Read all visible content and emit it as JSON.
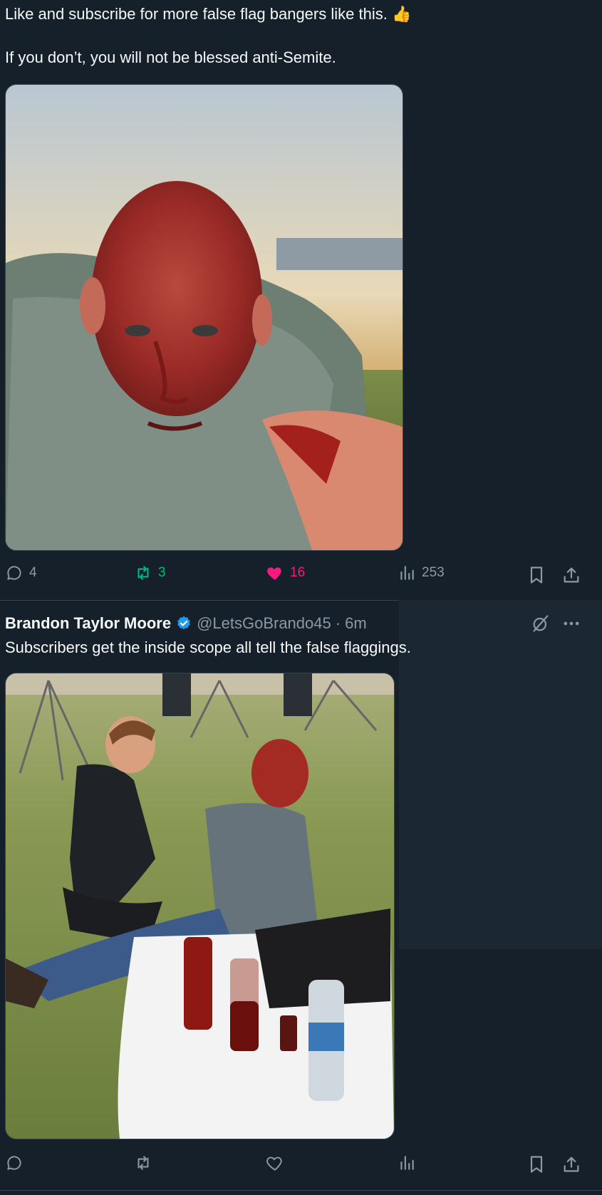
{
  "tweet1": {
    "line1": "Like and subscribe for more false flag bangers like this.",
    "line1_emoji": "👍",
    "line2": "If you don’t, you will not be blessed anti-Semite.",
    "media_icon": "photo",
    "actions": {
      "replies": "4",
      "reposts": "3",
      "likes": "16",
      "views": "253"
    }
  },
  "tweet2": {
    "author_name": "Brandon Taylor Moore",
    "verified": true,
    "handle": "@LetsGoBrando45",
    "separator": "·",
    "time": "6m",
    "text": "Subscribers get the inside scope all tell the false flaggings.",
    "media_icon": "photo",
    "actions": {
      "replies": "",
      "reposts": "",
      "likes": "",
      "views": ""
    }
  },
  "colors": {
    "background": "#15202b",
    "accent_blue": "#1d9bf0",
    "repost_green": "#00ba7c",
    "like_pink": "#f91880",
    "muted": "#8b98a5"
  }
}
